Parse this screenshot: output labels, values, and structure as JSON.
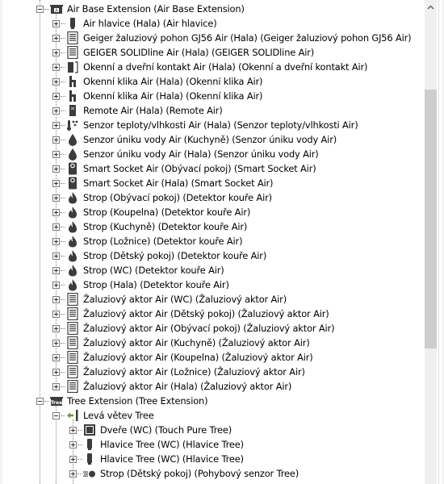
{
  "tree": {
    "nodes": [
      {
        "level": 0,
        "expanded": true,
        "icon": "air-base-extension-icon",
        "label": "Air Base Extension (Air Base Extension)"
      },
      {
        "level": 1,
        "expanded": false,
        "icon": "thermostat-head-icon",
        "label": "Air hlavice (Hala) (Air hlavice)"
      },
      {
        "level": 1,
        "expanded": false,
        "icon": "blind-icon",
        "label": "Geiger žaluziový pohon GJ56 Air (Hala) (Geiger žaluziový pohon GJ56 Air)"
      },
      {
        "level": 1,
        "expanded": false,
        "icon": "blind-icon",
        "label": "GEIGER SOLIDline Air (Hala) (GEIGER SOLIDline Air)"
      },
      {
        "level": 1,
        "expanded": false,
        "icon": "door-window-contact-icon",
        "label": "Okenní a dveřní kontakt Air (Hala) (Okenní a dveřní kontakt Air)"
      },
      {
        "level": 1,
        "expanded": false,
        "icon": "window-handle-icon",
        "label": "Okenní klika Air (Hala) (Okenní klika Air)"
      },
      {
        "level": 1,
        "expanded": false,
        "icon": "window-handle-icon",
        "label": "Okenní klika Air (Hala) (Okenní klika Air)"
      },
      {
        "level": 1,
        "expanded": false,
        "icon": "remote-icon",
        "label": "Remote Air (Hala) (Remote Air)"
      },
      {
        "level": 1,
        "expanded": false,
        "icon": "temperature-humidity-icon",
        "label": "Senzor teploty/vlhkosti Air (Hala) (Senzor teploty/vlhkosti Air)"
      },
      {
        "level": 1,
        "expanded": false,
        "icon": "water-drop-icon",
        "label": "Senzor úniku vody Air (Kuchyně) (Senzor úniku vody Air)"
      },
      {
        "level": 1,
        "expanded": false,
        "icon": "water-drop-icon",
        "label": "Senzor úniku vody Air (Hala) (Senzor úniku vody Air)"
      },
      {
        "level": 1,
        "expanded": false,
        "icon": "smart-socket-icon",
        "label": "Smart Socket Air (Obývací pokoj) (Smart Socket Air)"
      },
      {
        "level": 1,
        "expanded": false,
        "icon": "smart-socket-icon",
        "label": "Smart Socket Air (Hala) (Smart Socket Air)"
      },
      {
        "level": 1,
        "expanded": false,
        "icon": "flame-icon",
        "label": "Strop (Obývací pokoj) (Detektor kouře Air)"
      },
      {
        "level": 1,
        "expanded": false,
        "icon": "flame-icon",
        "label": "Strop (Koupelna) (Detektor kouře Air)"
      },
      {
        "level": 1,
        "expanded": false,
        "icon": "flame-icon",
        "label": "Strop (Kuchyně) (Detektor kouře Air)"
      },
      {
        "level": 1,
        "expanded": false,
        "icon": "flame-icon",
        "label": "Strop (Ložnice) (Detektor kouře Air)"
      },
      {
        "level": 1,
        "expanded": false,
        "icon": "flame-icon",
        "label": "Strop (Dětský pokoj) (Detektor kouře Air)"
      },
      {
        "level": 1,
        "expanded": false,
        "icon": "flame-icon",
        "label": "Strop (WC) (Detektor kouře Air)"
      },
      {
        "level": 1,
        "expanded": false,
        "icon": "flame-icon",
        "label": "Strop (Hala) (Detektor kouře Air)"
      },
      {
        "level": 1,
        "expanded": false,
        "icon": "blind-icon",
        "label": "Žaluziový aktor Air (WC) (Žaluziový aktor Air)"
      },
      {
        "level": 1,
        "expanded": false,
        "icon": "blind-icon",
        "label": "Žaluziový aktor Air (Dětský pokoj) (Žaluziový aktor Air)"
      },
      {
        "level": 1,
        "expanded": false,
        "icon": "blind-icon",
        "label": "Žaluziový aktor Air (Obývací pokoj) (Žaluziový aktor Air)"
      },
      {
        "level": 1,
        "expanded": false,
        "icon": "blind-icon",
        "label": "Žaluziový aktor Air (Kuchyně) (Žaluziový aktor Air)"
      },
      {
        "level": 1,
        "expanded": false,
        "icon": "blind-icon",
        "label": "Žaluziový aktor Air (Koupelna) (Žaluziový aktor Air)"
      },
      {
        "level": 1,
        "expanded": false,
        "icon": "blind-icon",
        "label": "Žaluziový aktor Air (Ložnice) (Žaluziový aktor Air)"
      },
      {
        "level": 1,
        "expanded": false,
        "icon": "blind-icon",
        "label": "Žaluziový aktor Air (Hala) (Žaluziový aktor Air)"
      },
      {
        "level": 0,
        "expanded": true,
        "icon": "tree-extension-icon",
        "label": "Tree Extension (Tree Extension)"
      },
      {
        "level": 1,
        "expanded": true,
        "icon": "left-branch-icon",
        "label": "Levá větev Tree"
      },
      {
        "level": 2,
        "expanded": false,
        "icon": "touch-pure-icon",
        "label": "Dveře (WC) (Touch Pure Tree)"
      },
      {
        "level": 2,
        "expanded": false,
        "icon": "thermostat-head-icon",
        "label": "Hlavice Tree (WC) (Hlavice Tree)"
      },
      {
        "level": 2,
        "expanded": false,
        "icon": "thermostat-head-icon",
        "label": "Hlavice Tree (WC) (Hlavice Tree)"
      },
      {
        "level": 2,
        "expanded": false,
        "icon": "motion-sensor-icon",
        "label": "Strop (Dětský pokoj) (Pohybový senzor Tree)"
      }
    ]
  },
  "scrollbar": {
    "up_arrow_icon": "chevron-up-icon",
    "position_fraction": 0.36,
    "visible_fraction": 0.55
  },
  "colors": {
    "icon_dark": "#3c3c3c",
    "branch_green": "#5aa02c",
    "scroll_thumb": "#cdcdcd",
    "scroll_track": "#f0f0f0"
  }
}
